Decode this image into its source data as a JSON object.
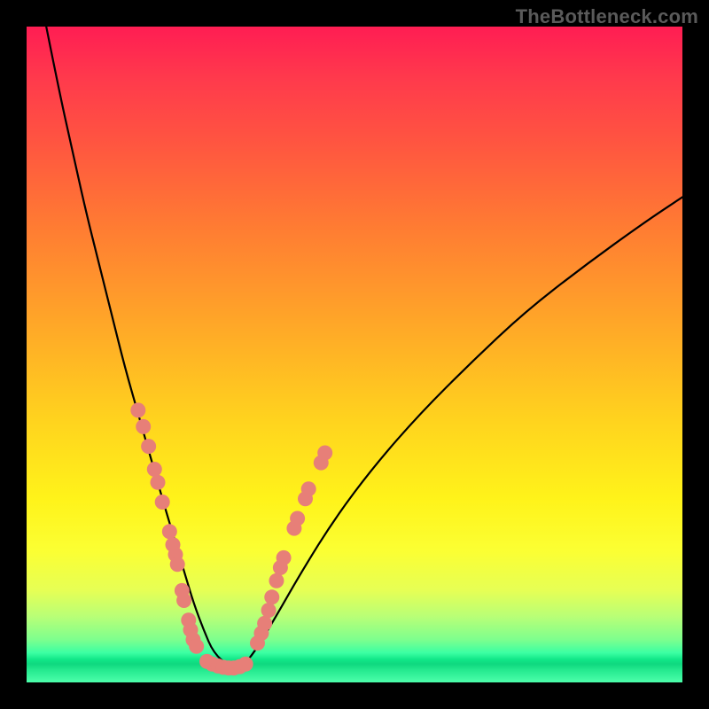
{
  "watermark": "TheBottleneck.com",
  "colors": {
    "curve_stroke": "#000000",
    "dot_fill": "#e77f78",
    "dot_stroke": "#c9574f"
  },
  "chart_data": {
    "type": "line",
    "title": "",
    "xlabel": "",
    "ylabel": "",
    "xlim": [
      0,
      100
    ],
    "ylim": [
      0,
      100
    ],
    "grid": false,
    "series": [
      {
        "name": "bottleneck-curve",
        "x": [
          3,
          5,
          7,
          9,
          11,
          13,
          15,
          17,
          19,
          21,
          22.5,
          24,
          25.5,
          27,
          28.5,
          31,
          33,
          35,
          38,
          42,
          47,
          53,
          60,
          68,
          76,
          85,
          94,
          100
        ],
        "y": [
          100,
          90,
          81,
          72,
          64,
          56,
          48,
          41,
          34,
          27,
          22,
          17,
          12,
          8,
          4.5,
          2.3,
          2.5,
          5,
          10,
          17,
          25,
          33,
          41,
          49,
          56.5,
          63.5,
          70,
          74
        ]
      }
    ],
    "dot_clusters": [
      {
        "name": "left-arm-dots",
        "points": [
          [
            17.0,
            41.5
          ],
          [
            17.8,
            39.0
          ],
          [
            18.6,
            36.0
          ],
          [
            19.5,
            32.5
          ],
          [
            20.0,
            30.5
          ],
          [
            20.7,
            27.5
          ],
          [
            21.8,
            23.0
          ],
          [
            22.3,
            21.0
          ],
          [
            22.7,
            19.5
          ],
          [
            23.0,
            18.0
          ],
          [
            23.7,
            14.0
          ],
          [
            24.0,
            12.5
          ],
          [
            24.7,
            9.5
          ],
          [
            25.0,
            8.0
          ],
          [
            25.4,
            6.5
          ],
          [
            25.9,
            5.5
          ]
        ]
      },
      {
        "name": "valley-dots",
        "points": [
          [
            27.5,
            3.2
          ],
          [
            28.3,
            2.8
          ],
          [
            29.2,
            2.5
          ],
          [
            30.0,
            2.3
          ],
          [
            30.8,
            2.2
          ],
          [
            31.6,
            2.2
          ],
          [
            32.5,
            2.4
          ],
          [
            33.4,
            2.8
          ]
        ]
      },
      {
        "name": "right-arm-dots",
        "points": [
          [
            35.2,
            6.0
          ],
          [
            35.8,
            7.5
          ],
          [
            36.3,
            9.0
          ],
          [
            36.9,
            11.0
          ],
          [
            37.4,
            13.0
          ],
          [
            38.1,
            15.5
          ],
          [
            38.7,
            17.5
          ],
          [
            39.2,
            19.0
          ],
          [
            40.8,
            23.5
          ],
          [
            41.3,
            25.0
          ],
          [
            42.5,
            28.0
          ],
          [
            43.0,
            29.5
          ],
          [
            44.9,
            33.5
          ],
          [
            45.5,
            35.0
          ]
        ]
      }
    ]
  }
}
